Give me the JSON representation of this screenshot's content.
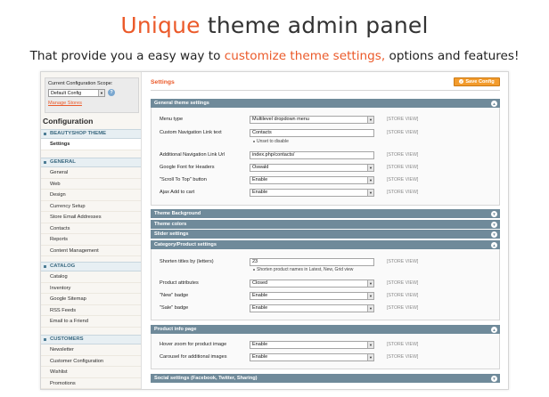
{
  "hero": {
    "title_accent": "Unique",
    "title_rest": " theme admin panel",
    "subtitle_prefix": "That provide you a easy way to ",
    "subtitle_accent": "customize theme settings,",
    "subtitle_suffix": " options and features!"
  },
  "colors": {
    "accent": "#eb5a2a",
    "section_header": "#6f8a9a",
    "save_button": "#f39c2d",
    "nav_header": "#3b6980"
  },
  "sidebar": {
    "scope_label": "Current Configuration Scope:",
    "scope_value": "Default Config",
    "manage_stores": "Manage Stores",
    "title": "Configuration",
    "sections": [
      {
        "title": "BEAUTYSHOP THEME",
        "items": [
          "Settings"
        ]
      },
      {
        "title": "GENERAL",
        "items": [
          "General",
          "Web",
          "Design",
          "Currency Setup",
          "Store Email Addresses",
          "Contacts",
          "Reports",
          "Content Management"
        ]
      },
      {
        "title": "CATALOG",
        "items": [
          "Catalog",
          "Inventory",
          "Google Sitemap",
          "RSS Feeds",
          "Email to a Friend"
        ]
      },
      {
        "title": "CUSTOMERS",
        "items": [
          "Newsletter",
          "Customer Configuration",
          "Wishlist",
          "Promotions"
        ]
      }
    ]
  },
  "main": {
    "title": "Settings",
    "save_label": "Save Config",
    "scope_tag": "[STORE VIEW]",
    "general": {
      "title": "General theme settings",
      "rows": [
        {
          "label": "Menu type",
          "value": "Multilevel dropdown menu",
          "type": "select"
        },
        {
          "label": "Custom Navigation Link text",
          "value": "Contacts",
          "type": "text",
          "note": "Unset to disable"
        },
        {
          "label": "Additional Navigation Link Url",
          "value": "index.php/contacts/",
          "type": "text"
        },
        {
          "label": "Google Font for Headers",
          "value": "Oswald",
          "type": "select"
        },
        {
          "label": "\"Scroll To Top\" button",
          "value": "Enable",
          "type": "select"
        },
        {
          "label": "Ajax Add to cart",
          "value": "Enable",
          "type": "select"
        }
      ]
    },
    "collapsed": [
      "Theme Background",
      "Theme colors",
      "Slider settings"
    ],
    "category": {
      "title": "Category/Product settings",
      "rows": [
        {
          "label": "Shorten titles by (letters)",
          "value": "23",
          "type": "text",
          "note": "Shorten product names in Latest, New, Grid view"
        },
        {
          "label": "Product attributes",
          "value": "Closed",
          "type": "select"
        },
        {
          "label": "\"New\" badge",
          "value": "Enable",
          "type": "select"
        },
        {
          "label": "\"Sale\" badge",
          "value": "Enable",
          "type": "select"
        }
      ]
    },
    "product_info": {
      "title": "Product info page",
      "rows": [
        {
          "label": "Hover zoom for product image",
          "value": "Enable",
          "type": "select"
        },
        {
          "label": "Carousel for additional images",
          "value": "Enable",
          "type": "select"
        }
      ]
    },
    "social": {
      "title": "Social settings (Facebook, Twitter, Sharing)"
    }
  }
}
